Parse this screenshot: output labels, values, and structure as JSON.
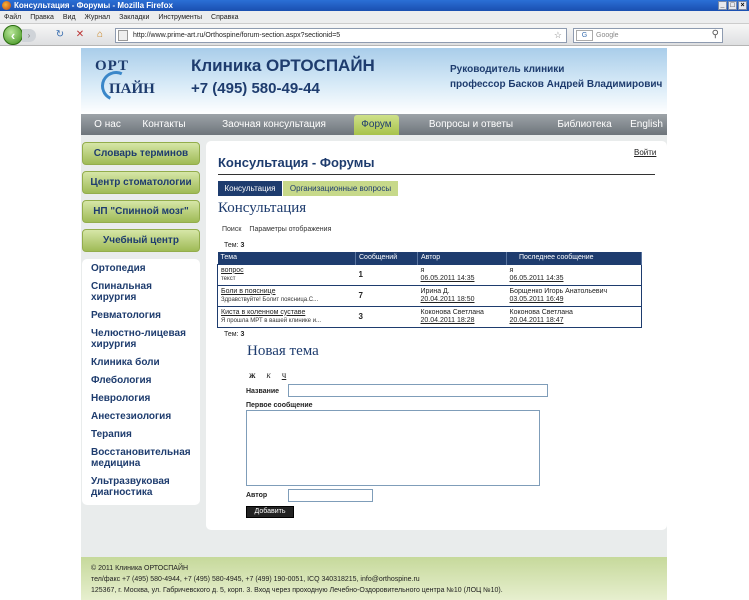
{
  "window": {
    "title": "Консультация - Форумы - Mozilla Firefox"
  },
  "menu": [
    "Файл",
    "Правка",
    "Вид",
    "Журнал",
    "Закладки",
    "Инструменты",
    "Справка"
  ],
  "browser": {
    "url": "http://www.prime-art.ru/Orthospine/forum-section.aspx?sectionid=5",
    "search_placeholder": "Google",
    "search_engine": "G"
  },
  "header": {
    "logo_top": "ОРТ",
    "logo_bottom": "ПАЙН",
    "clinic_name": "Клиника ОРТОСПАЙН",
    "phone": "+7 (495) 580-49-44",
    "head_title": "Руководитель клиники",
    "head_name": "профессор Басков Андрей Владимирович"
  },
  "topnav": [
    "О нас",
    "Контакты",
    "Заочная консультация",
    "Форум",
    "Вопросы и ответы",
    "Библиотека",
    "English"
  ],
  "sidebar": {
    "buttons": [
      "Словарь терминов",
      "Центр стоматологии",
      "НП \"Спинной мозг\"",
      "Учебный центр"
    ],
    "items": [
      "Ортопедия",
      "Спинальная хирургия",
      "Ревматология",
      "Челюстно-лицевая хирургия",
      "Клиника боли",
      "Флебология",
      "Неврология",
      "Анестезиология",
      "Терапия",
      "Восстановительная медицина",
      "Ультразвуковая диагностика"
    ]
  },
  "main": {
    "logout": "Войти",
    "title": "Консультация - Форумы",
    "tabs": [
      "Консультация",
      "Организационные вопросы"
    ],
    "section": "Консультация",
    "sublinks": [
      "Поиск",
      "Параметры отображения"
    ],
    "count_label": "Тем:",
    "count_value": "3",
    "columns": [
      "Тема",
      "Сообщений",
      "Автор",
      "Последнее сообщение"
    ],
    "rows": [
      {
        "topic": "вопрос",
        "excerpt": "текст",
        "count": "1",
        "author": "я",
        "author_date": "06.05.2011 14:35",
        "last_author": "я",
        "last_date": "06.05.2011 14:35"
      },
      {
        "topic": "Боли в пояснице",
        "excerpt": "Здравствуйте! Болит поясница.С...",
        "count": "7",
        "author": "Ирина Д.",
        "author_date": "20.04.2011 18:50",
        "last_author": "Борщенко Игорь Анатольевич",
        "last_date": "03.05.2011 16:49"
      },
      {
        "topic": "Киста в коленном суставе",
        "excerpt": "Я прошла МРТ в вашей клинике и...",
        "count": "3",
        "author": "Коконова Светлана",
        "author_date": "20.04.2011 18:28",
        "last_author": "Коконова Светлана",
        "last_date": "20.04.2011 18:47"
      }
    ],
    "new_topic": "Новая тема",
    "format_buttons": [
      "ж",
      "к",
      "ч"
    ],
    "label_name": "Название",
    "label_message": "Первое сообщение",
    "label_author": "Автор",
    "submit": "Добавить"
  },
  "footer": {
    "line1": "© 2011 Клиника ОРТОСПАЙН",
    "line2": "тел/факс +7 (495) 580-4944, +7 (495) 580-4945, +7 (499) 190-0051, ICQ 340318215, info@orthospine.ru",
    "line3": "125367, г. Москва, ул. Габричевского д. 5, корп. 3. Вход через проходную Лечебно-Оздоровительного центра №10 (ЛОЦ №10)."
  }
}
